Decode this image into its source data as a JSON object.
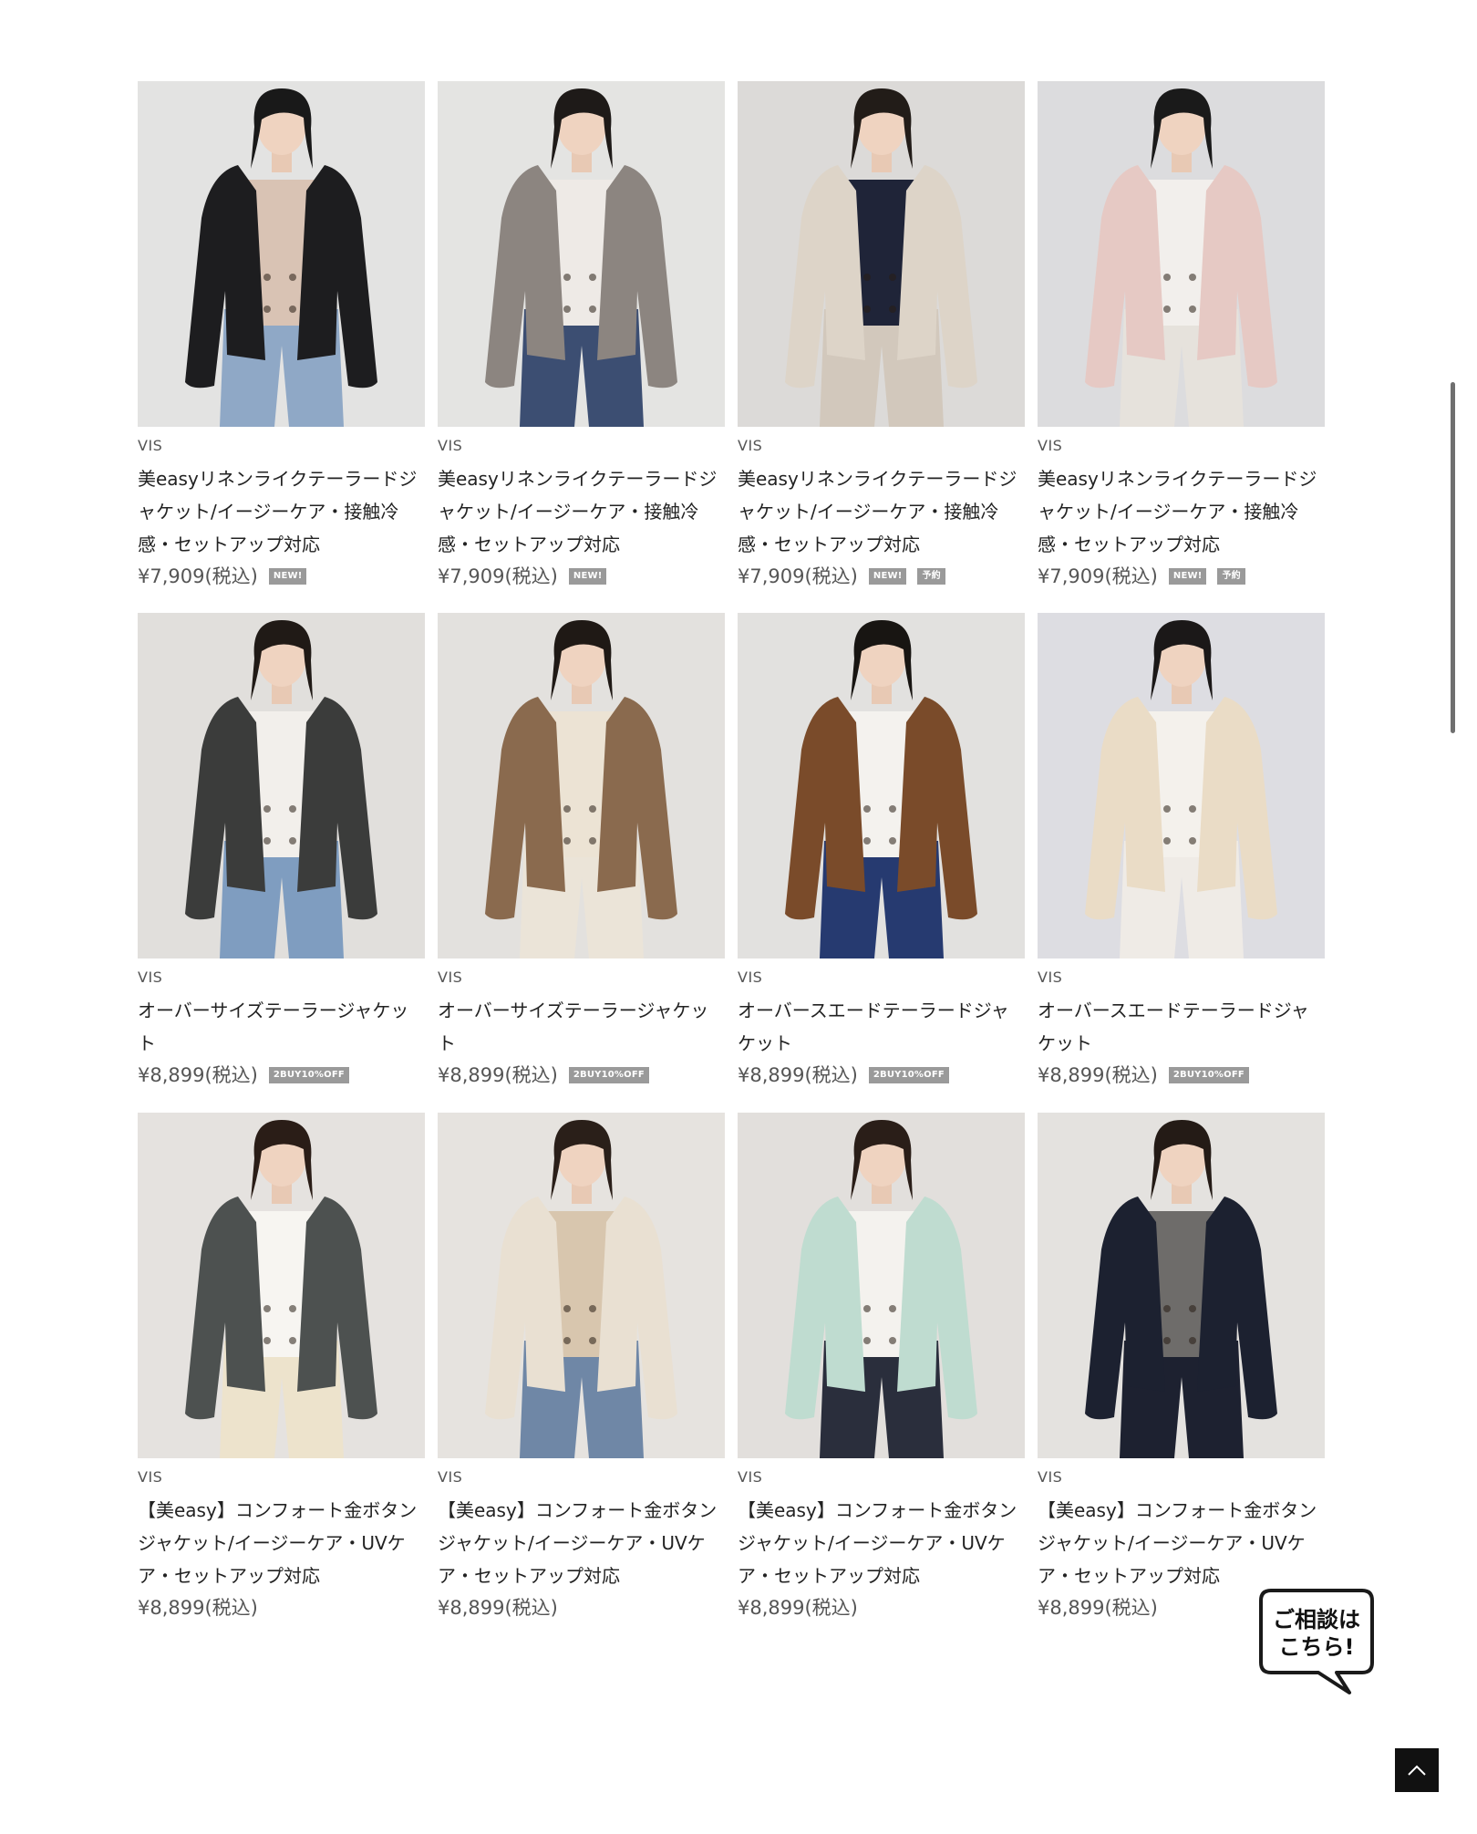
{
  "products": [
    {
      "brand": "VIS",
      "title": "美easyリネンライクテーラードジャケット/イージーケア・接触冷感・セットアップ対応",
      "price": "¥7,909(税込)",
      "badges": [
        "NEW!"
      ],
      "palette": {
        "bg": "#e3e3e2",
        "jacket": "#1d1d1f",
        "inner": "#d9c3b4",
        "pants": "#8fa8c6",
        "hair": "#191919"
      }
    },
    {
      "brand": "VIS",
      "title": "美easyリネンライクテーラードジャケット/イージーケア・接触冷感・セットアップ対応",
      "price": "¥7,909(税込)",
      "badges": [
        "NEW!"
      ],
      "palette": {
        "bg": "#e4e4e2",
        "jacket": "#8c8580",
        "inner": "#eeeae6",
        "pants": "#3c4e72",
        "hair": "#1e1a18"
      }
    },
    {
      "brand": "VIS",
      "title": "美easyリネンライクテーラードジャケット/イージーケア・接触冷感・セットアップ対応",
      "price": "¥7,909(税込)",
      "badges": [
        "NEW!",
        "予約"
      ],
      "palette": {
        "bg": "#dcdad8",
        "jacket": "#ddd4c8",
        "inner": "#1f2438",
        "pants": "#d2c8bc",
        "hair": "#221c18"
      }
    },
    {
      "brand": "VIS",
      "title": "美easyリネンライクテーラードジャケット/イージーケア・接触冷感・セットアップ対応",
      "price": "¥7,909(税込)",
      "badges": [
        "NEW!",
        "予約"
      ],
      "palette": {
        "bg": "#dcdcde",
        "jacket": "#e6c9c4",
        "inner": "#f2efec",
        "pants": "#e6e2dc",
        "hair": "#1a1a1a"
      }
    },
    {
      "brand": "VIS",
      "title": "オーバーサイズテーラージャケット",
      "price": "¥8,899(税込)",
      "badges": [
        "2BUY10%OFF"
      ],
      "palette": {
        "bg": "#e1dfdc",
        "jacket": "#3b3c3b",
        "inner": "#f2efeb",
        "pants": "#7f9dc0",
        "hair": "#201a16"
      }
    },
    {
      "brand": "VIS",
      "title": "オーバーサイズテーラージャケット",
      "price": "¥8,899(税込)",
      "badges": [
        "2BUY10%OFF"
      ],
      "palette": {
        "bg": "#e3e1de",
        "jacket": "#8a6a4e",
        "inner": "#ece3d4",
        "pants": "#ebe4d8",
        "hair": "#1f1915"
      }
    },
    {
      "brand": "VIS",
      "title": "オーバースエードテーラードジャケット",
      "price": "¥8,899(税込)",
      "badges": [
        "2BUY10%OFF"
      ],
      "palette": {
        "bg": "#e2e1df",
        "jacket": "#7a4b2a",
        "inner": "#f4f2ee",
        "pants": "#263a70",
        "hair": "#181512"
      }
    },
    {
      "brand": "VIS",
      "title": "オーバースエードテーラードジャケット",
      "price": "¥8,899(税込)",
      "badges": [
        "2BUY10%OFF"
      ],
      "palette": {
        "bg": "#dddde2",
        "jacket": "#eadcc6",
        "inner": "#f4f1ec",
        "pants": "#efebe6",
        "hair": "#1b1818"
      }
    },
    {
      "brand": "VIS",
      "title": "【美easy】コンフォート金ボタンジャケット/イージーケア・UVケア・セットアップ対応",
      "price": "¥8,899(税込)",
      "badges": [],
      "palette": {
        "bg": "#e5e2df",
        "jacket": "#4d5150",
        "inner": "#f7f5f1",
        "pants": "#ede3cc",
        "hair": "#2a1d17"
      }
    },
    {
      "brand": "VIS",
      "title": "【美easy】コンフォート金ボタンジャケット/イージーケア・UVケア・セットアップ対応",
      "price": "¥8,899(税込)",
      "badges": [],
      "palette": {
        "bg": "#e6e3df",
        "jacket": "#e9e0d2",
        "inner": "#d8c6ae",
        "pants": "#6f87a6",
        "hair": "#2a1f19"
      }
    },
    {
      "brand": "VIS",
      "title": "【美easy】コンフォート金ボタンジャケット/イージーケア・UVケア・セットアップ対応",
      "price": "¥8,899(税込)",
      "badges": [],
      "palette": {
        "bg": "#e2dfdc",
        "jacket": "#bfdcd0",
        "inner": "#f4f2ee",
        "pants": "#2a2e3c",
        "hair": "#2a1e18"
      }
    },
    {
      "brand": "VIS",
      "title": "【美easy】コンフォート金ボタンジャケット/イージーケア・UVケア・セットアップ対応",
      "price": "¥8,899(税込)",
      "badges": [],
      "palette": {
        "bg": "#e4e2df",
        "jacket": "#1c2130",
        "inner": "#6e6c6a",
        "pants": "#1d2130",
        "hair": "#241b16"
      }
    }
  ],
  "chat": {
    "label": "ご相談は\nこちら!"
  },
  "to_top": {
    "icon": "chevron-up-icon"
  },
  "colors": {
    "badge_bg": "#9a9a9a",
    "price_text": "#555555",
    "to_top_bg": "#111111"
  }
}
